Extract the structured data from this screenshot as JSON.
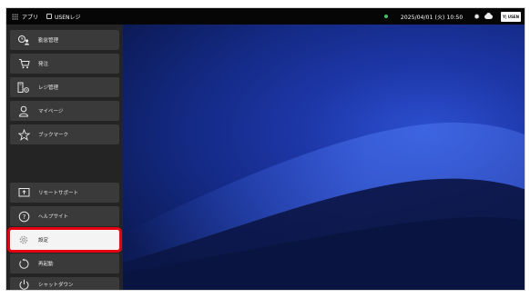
{
  "topbar": {
    "apps_label": "アプリ",
    "app_name": "USENレジ",
    "datetime": "2025/04/01 (火) 10:50",
    "logo_text": "Y| USEN"
  },
  "menu": {
    "top_items": [
      {
        "label": "勤怠管理",
        "icon": "attendance-icon"
      },
      {
        "label": "発注",
        "icon": "cart-icon"
      },
      {
        "label": "レジ管理",
        "icon": "register-settings-icon"
      },
      {
        "label": "マイページ",
        "icon": "person-icon"
      },
      {
        "label": "ブックマーク",
        "icon": "star-icon"
      }
    ],
    "bottom_items": [
      {
        "label": "リモートサポート",
        "icon": "remote-support-icon"
      },
      {
        "label": "ヘルプサイト",
        "icon": "help-icon"
      },
      {
        "label": "設定",
        "icon": "gear-icon"
      },
      {
        "label": "再起動",
        "icon": "restart-icon"
      },
      {
        "label": "シャットダウン",
        "icon": "power-icon"
      }
    ]
  },
  "colors": {
    "highlight": "#e60012",
    "status_dot": "#3cc36b",
    "wallpaper": "#1d36a6"
  }
}
